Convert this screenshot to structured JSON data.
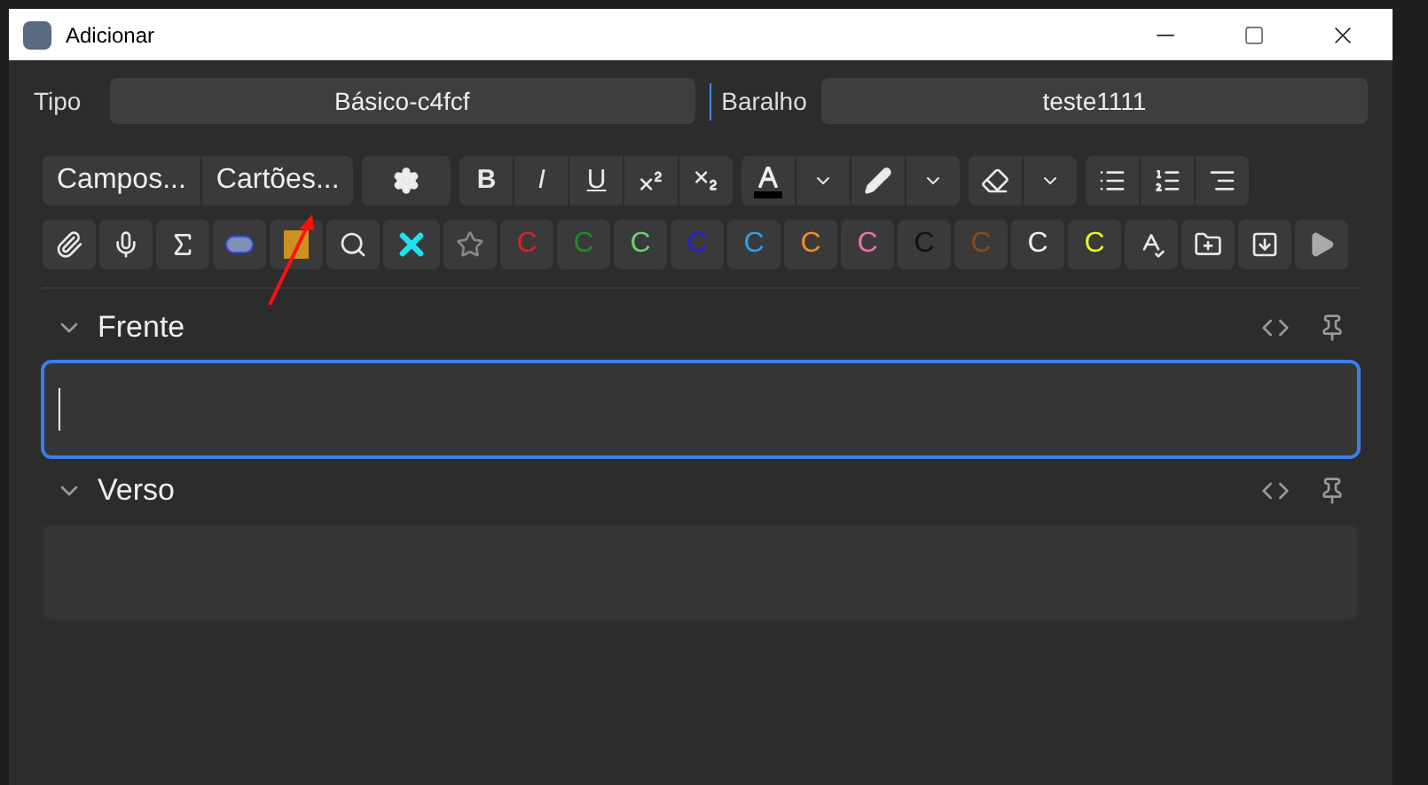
{
  "window": {
    "title": "Adicionar"
  },
  "note_type": {
    "label": "Tipo",
    "value": "Básico-c4fcf"
  },
  "deck": {
    "label": "Baralho",
    "value": "teste1111"
  },
  "note_type_buttons": [
    "Campos...",
    "Cartões..."
  ],
  "format_buttons": [
    "B",
    "I",
    "U"
  ],
  "color_buttons": [
    {
      "label": "C",
      "color": "#e02020"
    },
    {
      "label": "C",
      "color": "#1f8a2a"
    },
    {
      "label": "C",
      "color": "#6fd06f"
    },
    {
      "label": "C",
      "color": "#2020e0"
    },
    {
      "label": "C",
      "color": "#2aa0f0"
    },
    {
      "label": "C",
      "color": "#f09020"
    },
    {
      "label": "C",
      "color": "#f070b0"
    },
    {
      "label": "C",
      "color": "#111111"
    },
    {
      "label": "C",
      "color": "#8a4a1a"
    },
    {
      "label": "C",
      "color": "#f0f0f0"
    },
    {
      "label": "C",
      "color": "#f0f020"
    }
  ],
  "fields": [
    {
      "name": "Frente",
      "focused": true
    },
    {
      "name": "Verso",
      "focused": false
    }
  ]
}
